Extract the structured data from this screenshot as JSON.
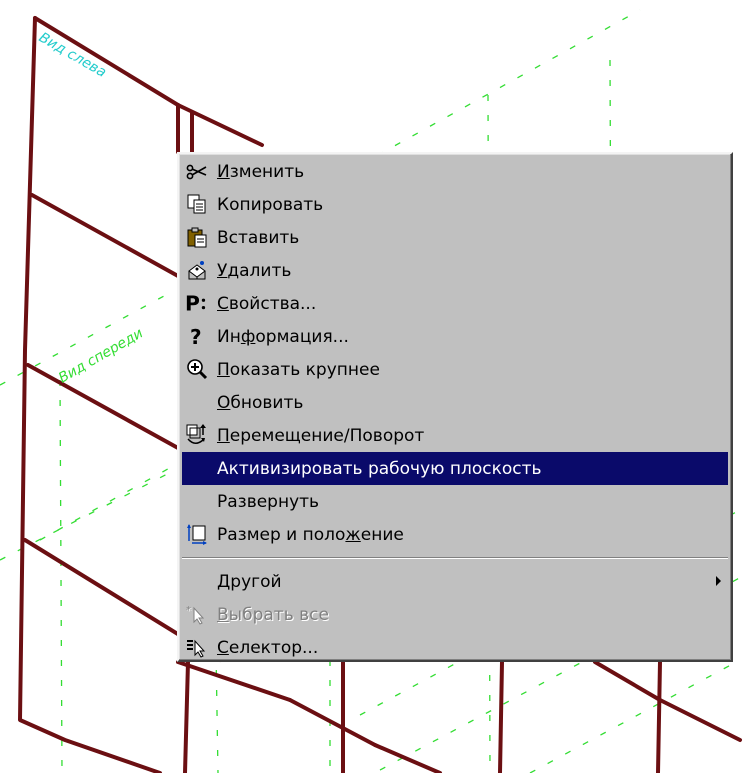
{
  "viewport": {
    "labels": {
      "left_view": "Вид слева",
      "front_view": "Вид спереди"
    },
    "colors": {
      "frame_line": "#6b0f12",
      "grid_line": "#33dd33",
      "left_label": "#22cccc",
      "front_label": "#33dd33"
    }
  },
  "context_menu": {
    "items": [
      {
        "id": "change",
        "icon": "scissors-icon",
        "pre": "",
        "acc": "И",
        "post": "зменить"
      },
      {
        "id": "copy",
        "icon": "copy-icon",
        "pre": "",
        "acc": "",
        "post": "Копировать"
      },
      {
        "id": "paste",
        "icon": "paste-icon",
        "pre": "",
        "acc": "",
        "post": "Вставить"
      },
      {
        "id": "delete",
        "icon": "delete-icon",
        "pre": "",
        "acc": "У",
        "post": "далить"
      },
      {
        "id": "properties",
        "icon": "properties-icon",
        "pre": "",
        "acc": "С",
        "post": "войства..."
      },
      {
        "id": "info",
        "icon": "question-icon",
        "pre": "Ин",
        "acc": "ф",
        "post": "ормация..."
      },
      {
        "id": "zoom",
        "icon": "zoom-in-icon",
        "pre": "",
        "acc": "П",
        "post": "оказать крупнее"
      },
      {
        "id": "refresh",
        "icon": "",
        "pre": "",
        "acc": "О",
        "post": "бновить"
      },
      {
        "id": "move-rotate",
        "icon": "move-rotate-icon",
        "pre": "",
        "acc": "П",
        "post": "еремещение/Поворот"
      },
      {
        "id": "activate-plane",
        "icon": "",
        "pre": "",
        "acc": "",
        "post": "Активизировать рабочую плоскость",
        "highlighted": true
      },
      {
        "id": "expand",
        "icon": "",
        "pre": "",
        "acc": "",
        "post": "Развернуть"
      },
      {
        "id": "size-position",
        "icon": "size-position-icon",
        "pre": "Размер и поло",
        "acc": "ж",
        "post": "ение"
      }
    ],
    "items_after_separator": [
      {
        "id": "other",
        "icon": "",
        "pre": "",
        "acc": "Д",
        "post": "ругой",
        "submenu": true
      },
      {
        "id": "select-all",
        "icon": "select-all-icon",
        "pre": "",
        "acc": "В",
        "post": "ыбрать все",
        "disabled": true
      },
      {
        "id": "selector",
        "icon": "selector-icon",
        "pre": "",
        "acc": "С",
        "post": "електор..."
      }
    ],
    "colors": {
      "background": "#c0c0c0",
      "highlight": "#0a0a6a",
      "highlight_text": "#ffffff",
      "disabled_text": "#808080"
    }
  }
}
